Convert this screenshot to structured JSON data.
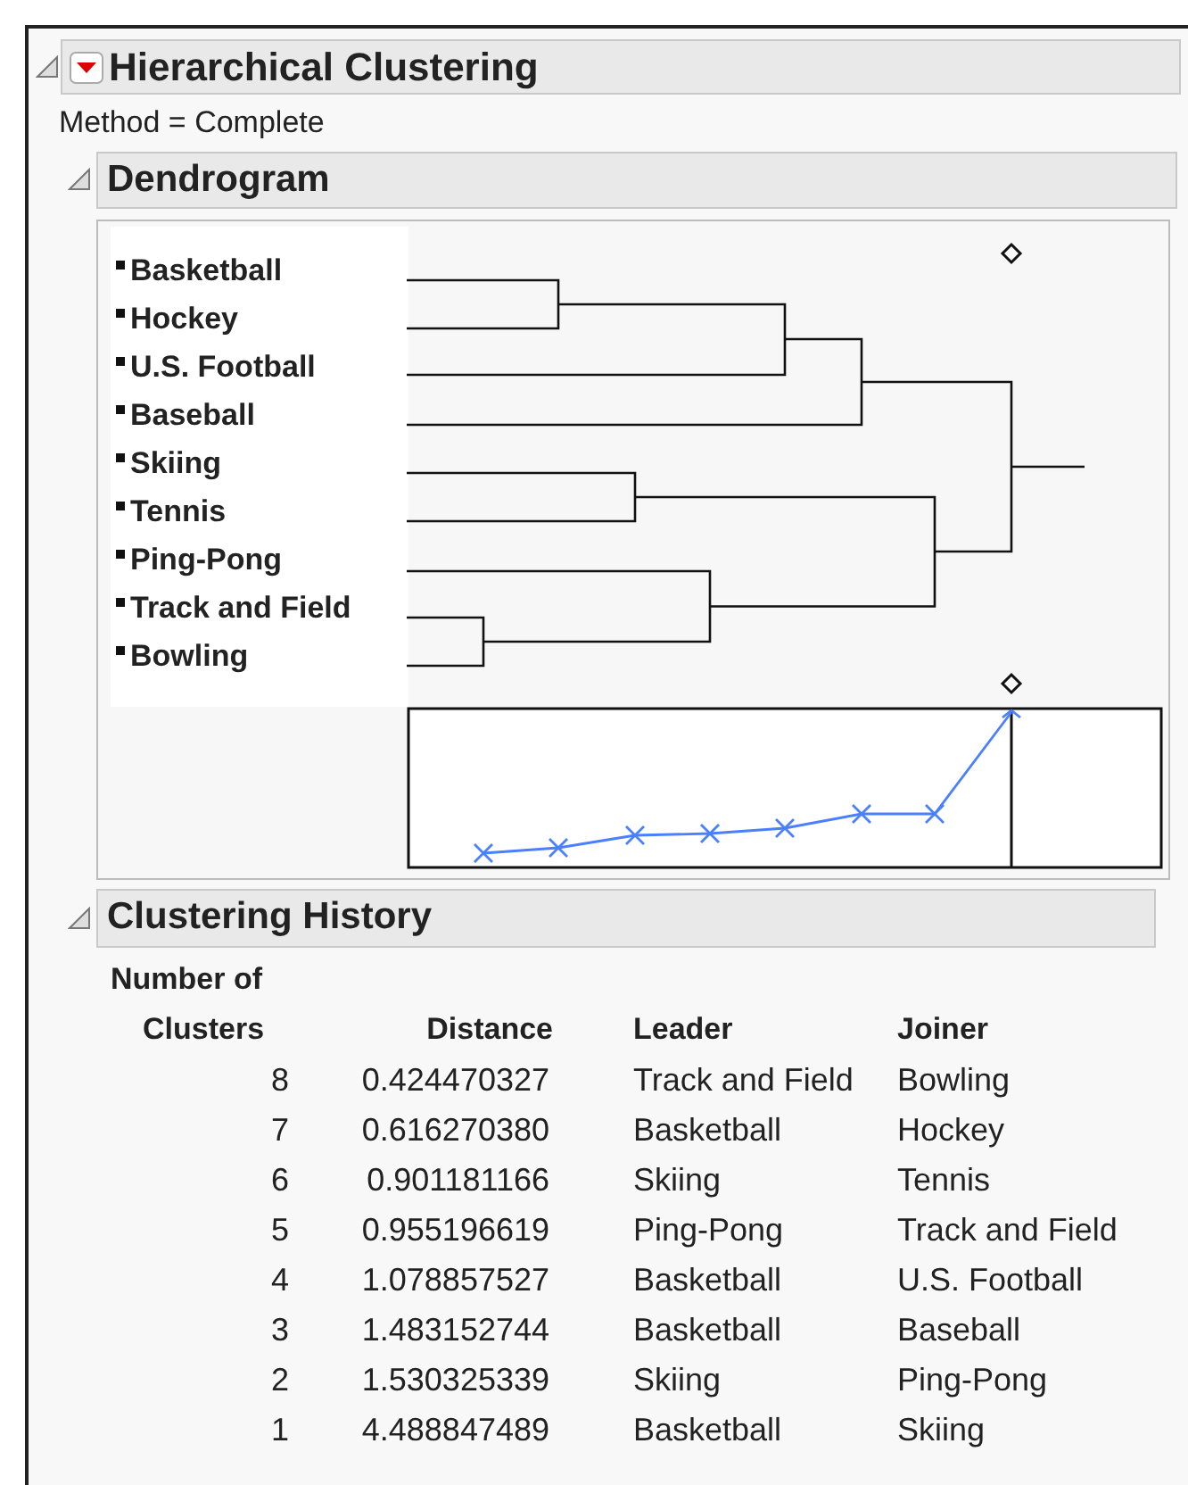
{
  "report": {
    "title": "Hierarchical Clustering",
    "method": "Method = Complete"
  },
  "dendrogram": {
    "title": "Dendrogram",
    "leaves": [
      "Basketball",
      "Hockey",
      "U.S. Football",
      "Baseball",
      "Skiing",
      "Tennis",
      "Ping-Pong",
      "Track and Field",
      "Bowling"
    ]
  },
  "clustering_history": {
    "title": "Clustering History",
    "columns": [
      {
        "lines": [
          "Number of",
          "Clusters"
        ]
      },
      {
        "lines": [
          "Distance"
        ]
      },
      {
        "lines": [
          "Leader"
        ]
      },
      {
        "lines": [
          "Joiner"
        ]
      }
    ],
    "rows": [
      [
        "8",
        "0.424470327",
        "Track and Field",
        "Bowling"
      ],
      [
        "7",
        "0.616270380",
        "Basketball",
        "Hockey"
      ],
      [
        "6",
        "0.901181166",
        "Skiing",
        "Tennis"
      ],
      [
        "5",
        "0.955196619",
        "Ping-Pong",
        "Track and Field"
      ],
      [
        "4",
        "1.078857527",
        "Basketball",
        "U.S. Football"
      ],
      [
        "3",
        "1.483152744",
        "Basketball",
        "Baseball"
      ],
      [
        "2",
        "1.530325339",
        "Skiing",
        "Ping-Pong"
      ],
      [
        "1",
        "4.488847489",
        "Basketball",
        "Skiing"
      ]
    ]
  }
}
